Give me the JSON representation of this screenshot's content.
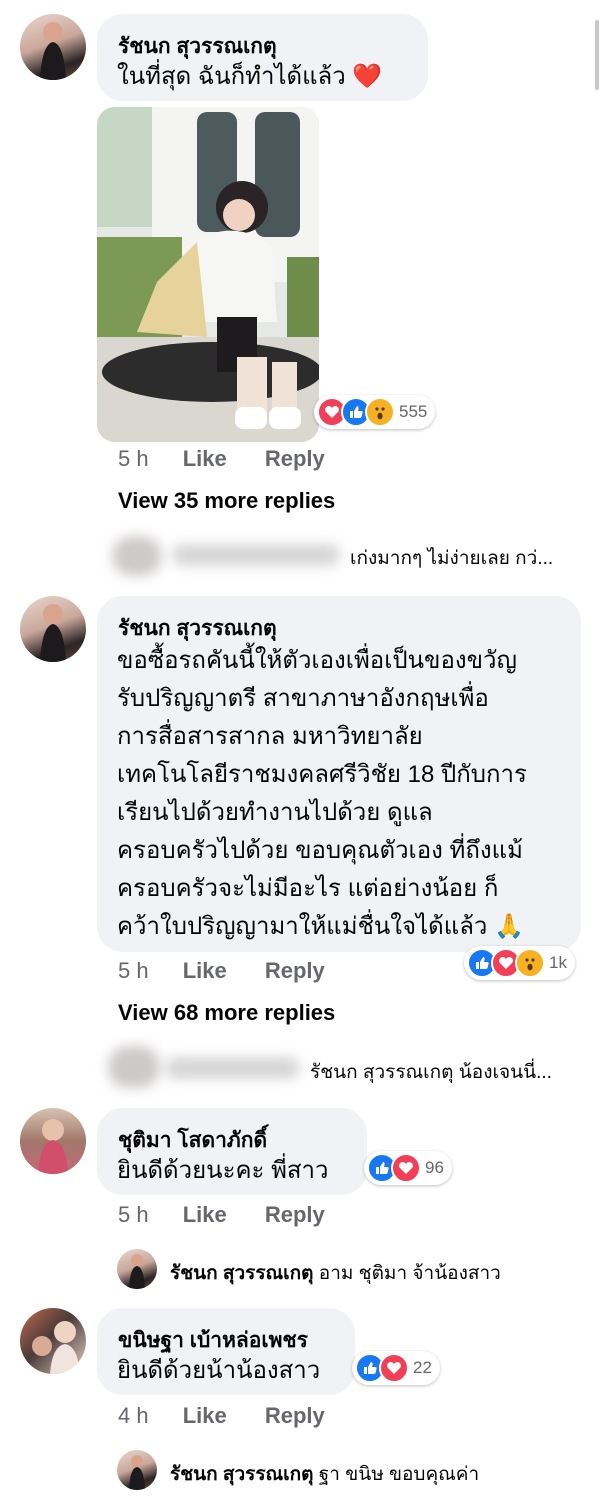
{
  "comments": [
    {
      "author": "รัชนก สุวรรณเกตุ",
      "lines": [
        "ในที่สุด ฉันก็ทำได้แล้ว ❤️"
      ],
      "reaction_icons": [
        "love-icon",
        "like-icon",
        "wow-icon"
      ],
      "reaction_count": "555",
      "time": "5 h",
      "like_label": "Like",
      "reply_label": "Reply",
      "view_more": "View 35 more replies",
      "reply_preview": "เก่งมากๆ ไม่ง่ายเลย กว่..."
    },
    {
      "author": "รัชนก สุวรรณเกตุ",
      "lines": [
        "ขอซื้อรถคันนี้ให้ตัวเองเพื่อเป็นของขวัญ",
        "รับปริญญาตรี สาขาภาษาอังกฤษเพื่อ",
        "การสื่อสารสากล มหาวิทยาลัย",
        "เทคโนโลยีราชมงคลศรีวิชัย 18 ปีกับการ",
        "เรียนไปด้วยทำงานไปด้วย ดูแล",
        "ครอบครัวไปด้วย ขอบคุณตัวเอง ที่ถึงแม้",
        "ครอบครัวจะไม่มีอะไร แต่อย่างน้อย ก็",
        "คว้าใบปริญญามาให้แม่ชื่นใจได้แล้ว 🙏"
      ],
      "reaction_icons": [
        "like-icon",
        "love-icon",
        "wow-icon"
      ],
      "reaction_count": "1k",
      "time": "5 h",
      "like_label": "Like",
      "reply_label": "Reply",
      "view_more": "View 68 more replies",
      "reply_preview": "รัชนก สุวรรณเกตุ น้องเจนนี่..."
    },
    {
      "author": "ชุติมา โสดาภักดิ์",
      "lines": [
        "ยินดีด้วยนะคะ พี่สาว"
      ],
      "reaction_icons": [
        "like-icon",
        "love-icon"
      ],
      "reaction_count": "96",
      "time": "5 h",
      "like_label": "Like",
      "reply_label": "Reply",
      "reply": {
        "author": "รัชนก สุวรรณเกตุ",
        "text": "อาม ชุติมา จ้าน้องสาว"
      }
    },
    {
      "author": "ขนิษฐา เบ้าหล่อเพชร",
      "lines": [
        "ยินดีด้วยน้าน้องสาว"
      ],
      "reaction_icons": [
        "like-icon",
        "love-icon"
      ],
      "reaction_count": "22",
      "time": "4 h",
      "like_label": "Like",
      "reply_label": "Reply",
      "reply": {
        "author": "รัชนก สุวรรณเกตุ",
        "text": "ฐา ขนิษ ขอบคุณค่า"
      }
    }
  ],
  "colors": {
    "bubble": "#f0f2f5",
    "meta": "#65676b",
    "like": "#1877f2",
    "love": "#f33e58",
    "wow": "#f7b125"
  }
}
